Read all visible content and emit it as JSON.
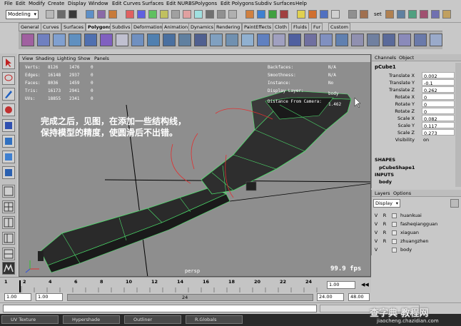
{
  "menubar": {
    "items": [
      "File",
      "Edit",
      "Modify",
      "Create",
      "Display",
      "Window",
      "Edit Curves",
      "Surfaces",
      "Edit NURBS",
      "Polygons",
      "Edit Polygons",
      "Subdiv Surfaces",
      "Help"
    ]
  },
  "status": {
    "mode": "Modeling",
    "field_label": "set"
  },
  "shelf": {
    "tabs": [
      "General",
      "Curves",
      "Surfaces",
      "Polygons",
      "Subdivs",
      "Deformation",
      "Animation",
      "Dynamics",
      "Rendering",
      "PaintEffects",
      "Cloth",
      "Fluids",
      "Fur",
      "Custom"
    ],
    "active_tab": "Polygons"
  },
  "viewport": {
    "menu": [
      "View",
      "Shading",
      "Lighting",
      "Show",
      "Panels"
    ],
    "hud_left": [
      {
        "label": "Verts:",
        "v1": "8126",
        "v2": "1476",
        "v3": "0"
      },
      {
        "label": "Edges:",
        "v1": "16148",
        "v2": "2937",
        "v3": "0"
      },
      {
        "label": "Faces:",
        "v1": "8036",
        "v2": "1459",
        "v3": "0"
      },
      {
        "label": "Tris:",
        "v1": "16173",
        "v2": "2941",
        "v3": "0"
      },
      {
        "label": "UVs:",
        "v1": "18855",
        "v2": "2341",
        "v3": "0"
      }
    ],
    "hud_right": [
      {
        "label": "Backfaces:",
        "value": "N/A"
      },
      {
        "label": "Smoothness:",
        "value": "N/A"
      },
      {
        "label": "Instance:",
        "value": "No"
      },
      {
        "label": "Display Layer:",
        "value": "body"
      },
      {
        "label": "Distance From Camera:",
        "value": "1.462"
      }
    ],
    "camera": "persp",
    "fps": "99.9 fps",
    "annotation_line1": "完成之后，见图，在添加一些结构线，",
    "annotation_line2": "保持模型的精度，使圆滑后不出错。"
  },
  "channelbox": {
    "tabs": [
      "Channels",
      "Object"
    ],
    "object": "pCube1",
    "attrs": [
      {
        "label": "Translate X",
        "value": "0.002"
      },
      {
        "label": "Translate Y",
        "value": "-0.1"
      },
      {
        "label": "Translate Z",
        "value": "0.262"
      },
      {
        "label": "Rotate X",
        "value": "0"
      },
      {
        "label": "Rotate Y",
        "value": "0"
      },
      {
        "label": "Rotate Z",
        "value": "0"
      },
      {
        "label": "Scale X",
        "value": "0.082"
      },
      {
        "label": "Scale Y",
        "value": "0.117"
      },
      {
        "label": "Scale Z",
        "value": "0.273"
      },
      {
        "label": "Visibility",
        "value": "on"
      }
    ],
    "shapes_header": "SHAPES",
    "shape_name": "pCubeShape1",
    "inputs_header": "INPUTS",
    "input_name": "body"
  },
  "layers": {
    "tabs": [
      "Layers",
      "Options"
    ],
    "dropdown": "Display",
    "rows": [
      {
        "v": "V",
        "r": "R",
        "name": "huankuai"
      },
      {
        "v": "V",
        "r": "R",
        "name": "fasheqiangguan"
      },
      {
        "v": "V",
        "r": "R",
        "name": "xiaguan"
      },
      {
        "v": "V",
        "r": "R",
        "name": "zhuangzhen"
      },
      {
        "v": "V",
        "r": "",
        "name": "body"
      }
    ]
  },
  "timeline": {
    "ticks": [
      "1",
      "2",
      "4",
      "6",
      "8",
      "10",
      "12",
      "14",
      "16",
      "18",
      "20",
      "22",
      "24"
    ],
    "current_frame": "1.00",
    "range_start": "1.00",
    "range_start2": "1.00",
    "range_end": "24.00",
    "range_end2": "48.00",
    "slider_label": "24"
  },
  "taskbar": {
    "items": [
      "UV Texture",
      "Hypershade",
      "Outliner",
      "R.Globals"
    ]
  },
  "watermark": {
    "cn": "查字典 教程网",
    "url": "jiaocheng.chazidian.com"
  }
}
